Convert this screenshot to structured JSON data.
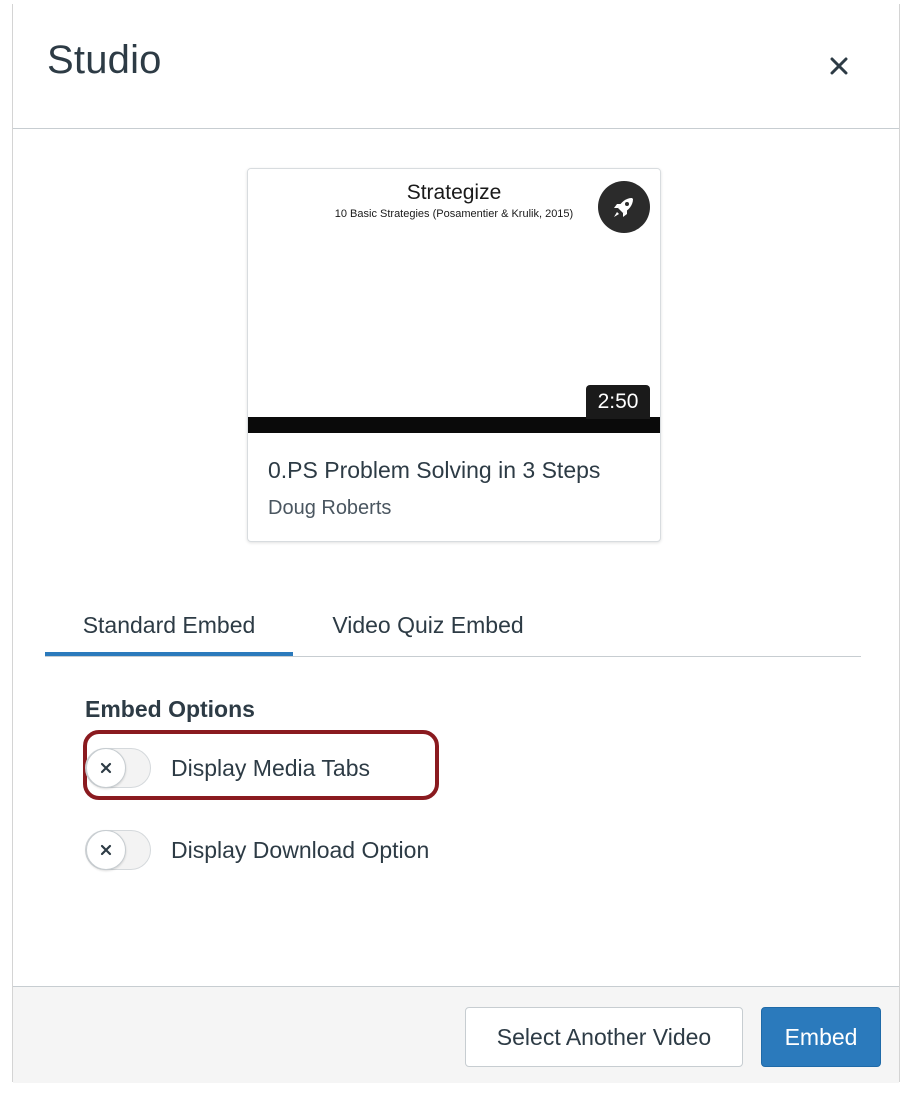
{
  "dialog": {
    "title": "Studio",
    "close_icon": "close-icon"
  },
  "video_card": {
    "thumbnail_title": "Strategize",
    "thumbnail_subtitle": "10 Basic Strategies (Posamentier & Krulik, 2015)",
    "badge_icon": "rocket-icon",
    "duration": "2:50",
    "title": "0.PS Problem Solving in 3 Steps",
    "author": "Doug Roberts"
  },
  "tabs": [
    {
      "label": "Standard Embed",
      "selected": true
    },
    {
      "label": "Video Quiz Embed",
      "selected": false
    }
  ],
  "embed_options": {
    "heading": "Embed Options",
    "options": [
      {
        "label": "Display Media Tabs",
        "enabled": false,
        "highlighted": true
      },
      {
        "label": "Display Download Option",
        "enabled": false,
        "highlighted": false
      }
    ]
  },
  "footer": {
    "select_another_label": "Select Another Video",
    "embed_label": "Embed"
  },
  "colors": {
    "accent": "#2b7abc",
    "highlight_border": "#8a1a1f",
    "text": "#2d3b45"
  }
}
